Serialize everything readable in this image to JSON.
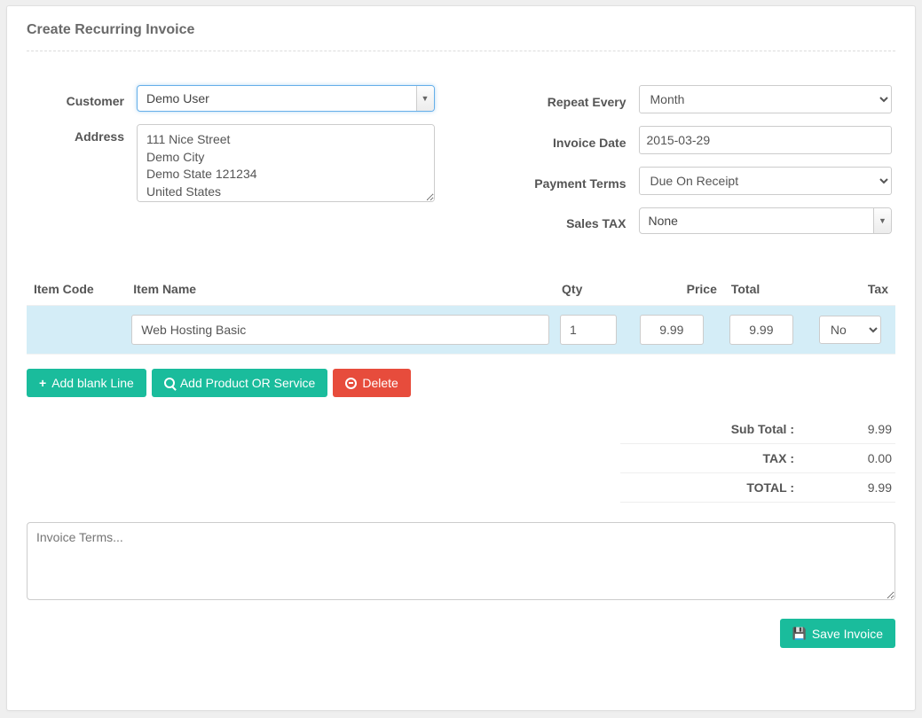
{
  "title": "Create Recurring Invoice",
  "left": {
    "customer_label": "Customer",
    "customer_value": "Demo User",
    "address_label": "Address",
    "address_value": "111 Nice Street\nDemo City\nDemo State 121234\nUnited States"
  },
  "right": {
    "repeat_label": "Repeat Every",
    "repeat_value": "Month",
    "invoice_date_label": "Invoice Date",
    "invoice_date_value": "2015-03-29",
    "terms_label": "Payment Terms",
    "terms_value": "Due On Receipt",
    "tax_label": "Sales TAX",
    "tax_value": "None"
  },
  "table": {
    "headers": {
      "code": "Item Code",
      "name": "Item Name",
      "qty": "Qty",
      "price": "Price",
      "total": "Total",
      "tax": "Tax"
    },
    "row": {
      "code": "",
      "name": "Web Hosting Basic",
      "qty": "1",
      "price": "9.99",
      "total": "9.99",
      "tax": "No"
    }
  },
  "buttons": {
    "add_blank": "Add blank Line",
    "add_product": "Add Product OR Service",
    "delete": "Delete",
    "save": "Save Invoice"
  },
  "totals": {
    "subtotal_label": "Sub Total :",
    "subtotal_value": "9.99",
    "tax_label": "TAX :",
    "tax_value": "0.00",
    "total_label": "TOTAL :",
    "total_value": "9.99"
  },
  "terms_placeholder": "Invoice Terms..."
}
